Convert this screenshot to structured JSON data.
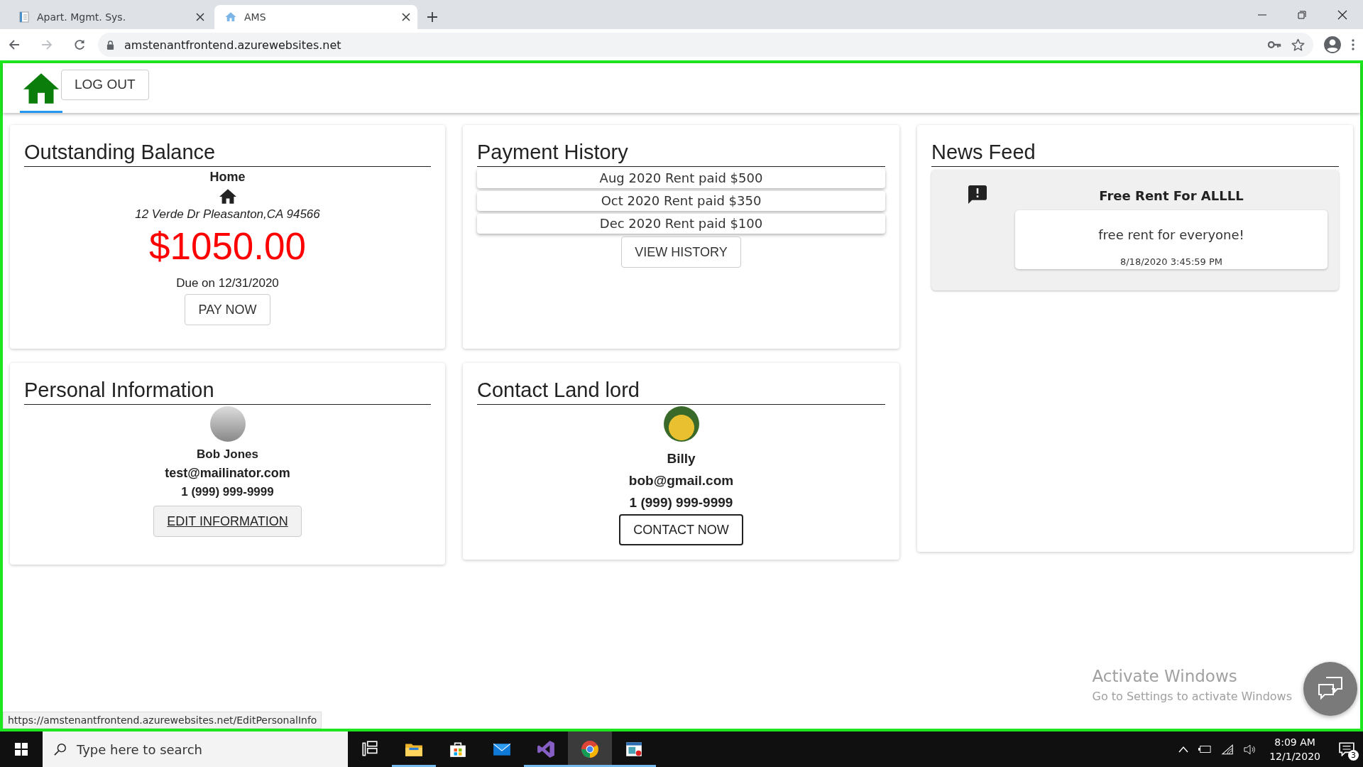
{
  "browser": {
    "tabs": [
      {
        "title": "Apart. Mgmt. Sys.",
        "selected": false
      },
      {
        "title": "AMS",
        "selected": true
      }
    ],
    "url": "amstenantfrontend.azurewebsites.net",
    "status_url": "https://amstenantfrontend.azurewebsites.net/EditPersonalInfo"
  },
  "nav": {
    "home_tab": {
      "selected": true
    },
    "logout_button": "LOG OUT"
  },
  "cards": [
    {
      "kind": "balance",
      "title": "Outstanding Balance",
      "property": "Home",
      "address": "12 Verde Dr Pleasanton,CA 94566",
      "amount": "$1050.00",
      "due": "Due on 12/31/2020",
      "button": "PAY NOW"
    },
    {
      "kind": "payments",
      "title": "Payment History",
      "payments": [
        "Aug 2020 Rent paid $500",
        "Oct 2020 Rent paid $350",
        "Dec 2020 Rent paid $100"
      ],
      "button": "VIEW HISTORY"
    },
    {
      "kind": "news",
      "title": "News Feed",
      "items": [
        {
          "title": "Free Rent For ALLLL",
          "body": "free rent for everyone!",
          "timestamp": "8/18/2020 3:45:59 PM"
        }
      ]
    },
    {
      "kind": "profile",
      "title": "Personal Information",
      "name": "Bob Jones",
      "email": "test@mailinator.com",
      "phone": "1 (999) 999-9999",
      "button": {
        "label": "EDIT INFORMATION",
        "hovered": true
      }
    },
    {
      "kind": "contact",
      "title": "Contact Land lord",
      "name": "Billy",
      "email": "bob@gmail.com",
      "phone": "1 (999) 999-9999",
      "button": {
        "label": "CONTACT NOW",
        "focused": true
      }
    }
  ],
  "windows_activation": {
    "title": "Activate Windows",
    "subtitle": "Go to Settings to activate Windows"
  },
  "taskbar": {
    "search_placeholder": "Type here to search",
    "apps": [
      {
        "kind": "task-view",
        "running": false,
        "selected": false
      },
      {
        "kind": "file-explorer",
        "running": true,
        "selected": false
      },
      {
        "kind": "store",
        "running": false,
        "selected": false
      },
      {
        "kind": "mail",
        "running": false,
        "selected": false
      },
      {
        "kind": "visual-studio",
        "running": true,
        "selected": false
      },
      {
        "kind": "chrome",
        "running": true,
        "selected": true
      },
      {
        "kind": "app-window",
        "running": true,
        "selected": false
      }
    ],
    "time": "8:09 AM",
    "date": "12/1/2020",
    "notification_count": "3"
  }
}
